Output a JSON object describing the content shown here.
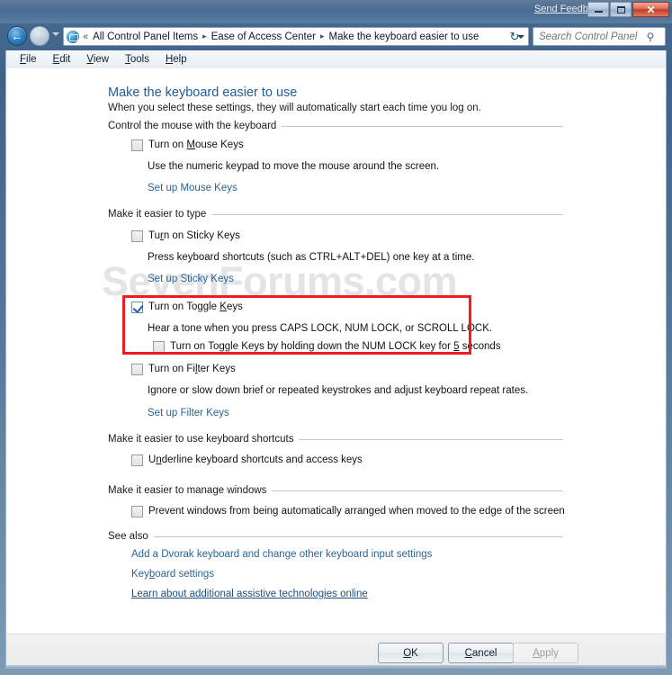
{
  "titlebar": {
    "send_feedback": "Send Feedback",
    "minimize_label": "Minimize",
    "maximize_label": "Maximize",
    "close_label": "Close",
    "close_glyph": "✕"
  },
  "navbar": {
    "back_label": "Back",
    "back_glyph": "←",
    "forward_label": "Forward",
    "forward_glyph": "→",
    "recent_pages_label": "Recent pages",
    "control_panel_icon": "control-panel-icon",
    "crumb_prefix": "«",
    "breadcrumbs": [
      {
        "label": "All Control Panel Items"
      },
      {
        "label": "Ease of Access Center"
      },
      {
        "label": "Make the keyboard easier to use"
      }
    ],
    "crumb_arrow": "▸",
    "refresh_glyph": "↻",
    "refresh_label": "Refresh"
  },
  "search": {
    "placeholder": "Search Control Panel",
    "value": "",
    "icon_glyph": "⚲"
  },
  "menubar": {
    "items": [
      {
        "pre": "",
        "accel": "F",
        "post": "ile"
      },
      {
        "pre": "",
        "accel": "E",
        "post": "dit"
      },
      {
        "pre": "",
        "accel": "V",
        "post": "iew"
      },
      {
        "pre": "",
        "accel": "T",
        "post": "ools"
      },
      {
        "pre": "",
        "accel": "H",
        "post": "elp"
      }
    ]
  },
  "watermark": "SevenForums.com",
  "page": {
    "title": "Make the keyboard easier to use",
    "subtitle": "When you select these settings, they will automatically start each time you log on."
  },
  "sections": {
    "mouse_keys": {
      "group_label": "Control the mouse with the keyboard",
      "checkbox": {
        "pre": "Turn on ",
        "accel": "M",
        "post": "ouse Keys",
        "checked": false
      },
      "description": "Use the numeric keypad to move the mouse around the screen.",
      "link": "Set up Mouse Keys"
    },
    "typing": {
      "group_label": "Make it easier to type",
      "sticky": {
        "checkbox": {
          "pre": "Tu",
          "accel": "r",
          "post": "n on Sticky Keys",
          "checked": false
        },
        "description": "Press keyboard shortcuts (such as CTRL+ALT+DEL) one key at a time.",
        "link": "Set up Sticky Keys"
      },
      "toggle": {
        "checkbox": {
          "pre": "Turn on Toggle ",
          "accel": "K",
          "post": "eys",
          "checked": true
        },
        "description": "Hear a tone when you press CAPS LOCK, NUM LOCK, or SCROLL LOCK.",
        "sub_checkbox": {
          "pre": "Turn on Toggle Keys by holding down the NUM LOCK key for ",
          "accel": "5",
          "post": " seconds",
          "checked": false
        },
        "highlight_color": "#ee1c1c"
      },
      "filter": {
        "checkbox": {
          "pre": "Turn on Fi",
          "accel": "l",
          "post": "ter Keys",
          "checked": false
        },
        "description": "Ignore or slow down brief or repeated keystrokes and adjust keyboard repeat rates.",
        "link": "Set up Filter Keys"
      }
    },
    "shortcuts": {
      "group_label": "Make it easier to use keyboard shortcuts",
      "checkbox": {
        "pre": "U",
        "accel": "n",
        "post": "derline keyboard shortcuts and access keys",
        "checked": false
      }
    },
    "windows": {
      "group_label": "Make it easier to manage windows",
      "checkbox": {
        "pre": "Prevent windows from being automatically arranged when moved to the edge of the screen",
        "accel": "",
        "post": "",
        "checked": false
      }
    },
    "see_also": {
      "group_label": "See also",
      "links": [
        {
          "pre": "Add a Dvorak keyboard and chan",
          "accel": "g",
          "post": "e other keyboard input settings",
          "hover": false
        },
        {
          "pre": "Key",
          "accel": "b",
          "post": "oard settings",
          "hover": false
        },
        {
          "pre": "Learn about additional assistive technologies online",
          "accel": "",
          "post": "",
          "hover": true
        }
      ]
    }
  },
  "footer": {
    "ok": {
      "pre": "",
      "accel": "O",
      "post": "K",
      "enabled": true
    },
    "cancel": {
      "pre": "",
      "accel": "C",
      "post": "ancel",
      "enabled": true
    },
    "apply": {
      "pre": "",
      "accel": "A",
      "post": "pply",
      "enabled": false
    }
  },
  "colors": {
    "accent_blue": "#1c5e9e",
    "link_blue": "#2a6496",
    "highlight_red": "#ee1c1c",
    "checkmark_blue": "#1f62a8"
  }
}
